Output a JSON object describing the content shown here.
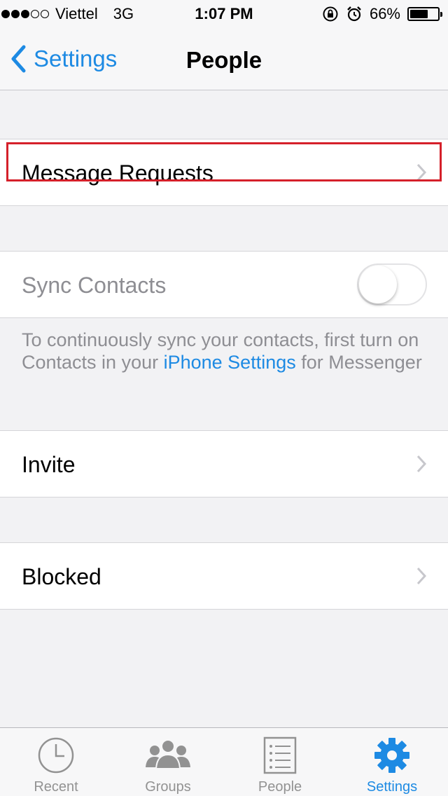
{
  "status_bar": {
    "carrier": "Viettel",
    "network": "3G",
    "time": "1:07 PM",
    "battery": "66%",
    "battery_level": 0.66,
    "signal_bars": 3,
    "signal_total": 5
  },
  "nav": {
    "back_label": "Settings",
    "title": "People"
  },
  "rows": {
    "message_requests": "Message Requests",
    "sync_contacts": "Sync Contacts",
    "sync_contacts_enabled": false,
    "invite": "Invite",
    "blocked": "Blocked"
  },
  "footnote": {
    "text_before": "To continuously sync your contacts, first turn on Contacts in your ",
    "link": "iPhone Settings",
    "text_after": " for Messenger"
  },
  "tabs": [
    {
      "label": "Recent",
      "icon": "clock-icon",
      "active": false
    },
    {
      "label": "Groups",
      "icon": "groups-icon",
      "active": false
    },
    {
      "label": "People",
      "icon": "people-list-icon",
      "active": false
    },
    {
      "label": "Settings",
      "icon": "gear-icon",
      "active": true
    }
  ],
  "colors": {
    "accent": "#1d8ae3",
    "highlight": "#d5202a",
    "inactive_tab": "#929292"
  }
}
